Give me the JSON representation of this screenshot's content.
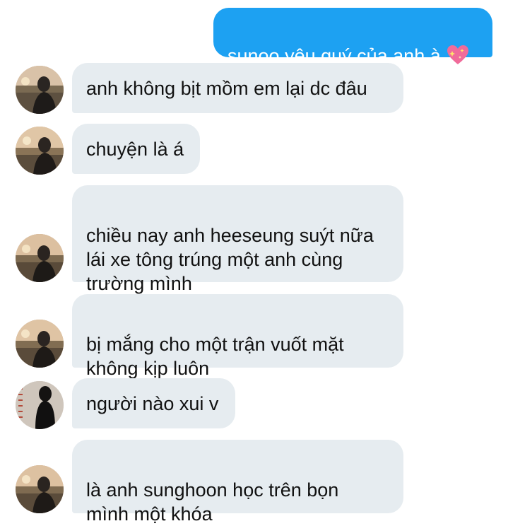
{
  "messages": [
    {
      "side": "out",
      "text": "sunoo yêu quý của anh à"
    },
    {
      "side": "in",
      "text": "anh không bịt mồm em lại dc đâu"
    },
    {
      "side": "in",
      "text": "chuyện là á"
    },
    {
      "side": "in",
      "text": "chiều nay anh heeseung suýt nữa\nlái xe tông trúng một anh cùng\ntrường mình"
    },
    {
      "side": "in",
      "text": "bị mắng cho một trận vuốt mặt\nkhông kịp luôn"
    },
    {
      "side": "in",
      "text": "người nào xui v"
    },
    {
      "side": "in",
      "text": "là anh sunghoon học trên bọn\nmình một khóa"
    }
  ],
  "emoji": "sparkling-heart-icon",
  "colors": {
    "outgoing_bubble": "#1da1f2",
    "incoming_bubble": "#e6ecf0",
    "text": "#111111",
    "outgoing_text": "#ffffff"
  }
}
